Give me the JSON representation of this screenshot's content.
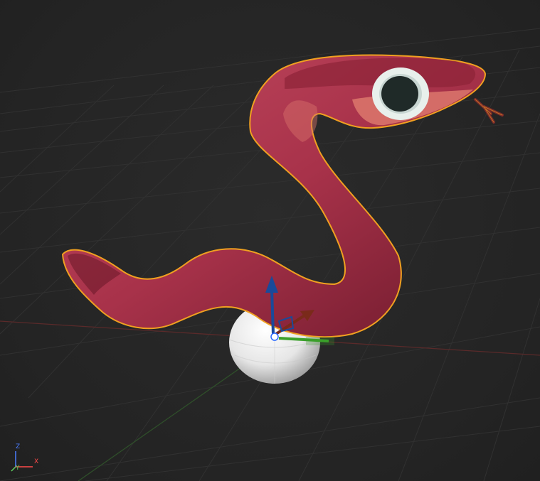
{
  "viewport": {
    "background": "#262626",
    "grid_color": "#313131",
    "x_axis_color": "#5a2a2a",
    "y_axis_color": "#2f4f2a",
    "selection_outline_color": "#f0a020"
  },
  "object": {
    "name": "snake",
    "body_color": "#a8324a",
    "body_shadow_color": "#6e1a2c",
    "belly_color": "#d9736a",
    "eye_outer_color": "#e8f0ec",
    "eye_pupil_color": "#1f2a28",
    "tongue_color": "#7a2a2a"
  },
  "base_sphere": {
    "color": "#f2f2f2"
  },
  "gizmo": {
    "z_color": "#1a4a9a",
    "x_color": "#7a2a1a",
    "y_color": "#3aa02a",
    "center_icon": "object-origin-icon"
  },
  "axis_widget": {
    "x_label": "X",
    "y_label": "Y",
    "z_label": "Z"
  }
}
